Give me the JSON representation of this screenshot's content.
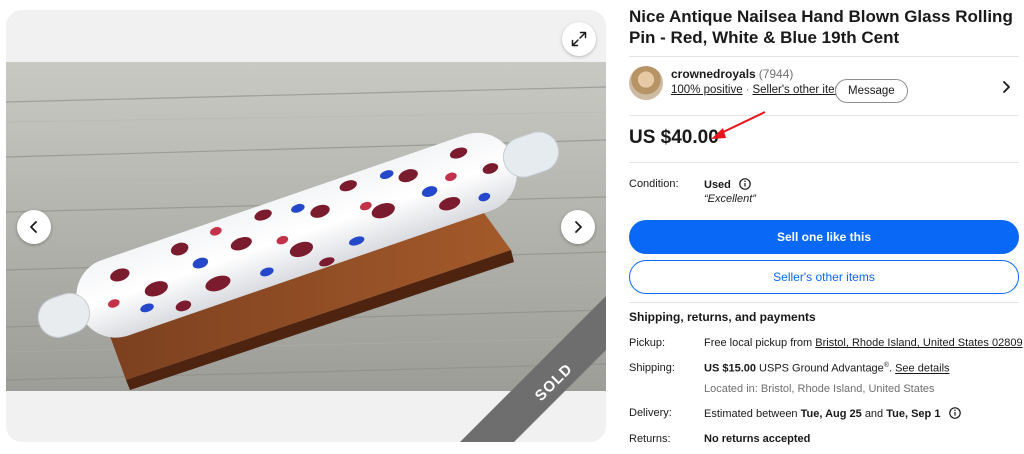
{
  "gallery": {
    "sold_label": "SOLD"
  },
  "listing": {
    "title": "Nice Antique Nailsea Hand Blown Glass Rolling Pin - Red, White & Blue 19th Cent",
    "price": "US $40.00"
  },
  "seller": {
    "name": "crownedroyals",
    "score": "(7944)",
    "positive": "100% positive",
    "other_items": "Seller's other items",
    "message_label": "Message"
  },
  "condition": {
    "label": "Condition:",
    "value": "Used",
    "note": "“Excellent”"
  },
  "actions": {
    "sell_one": "Sell one like this",
    "sellers_other_items": "Seller's other items"
  },
  "shipping": {
    "section_title": "Shipping, returns, and payments",
    "pickup_label": "Pickup:",
    "pickup_text": "Free local pickup from",
    "pickup_location": "Bristol, Rhode Island, United States 02809",
    "shipping_label": "Shipping:",
    "shipping_price": "US $15.00",
    "shipping_service": "USPS Ground Advantage",
    "shipping_reg": "®",
    "see_details": "See details",
    "located_in": "Located in: Bristol, Rhode Island, United States",
    "delivery_label": "Delivery:",
    "delivery_prefix": "Estimated between",
    "delivery_start": "Tue, Aug 25",
    "delivery_and": "and",
    "delivery_end": "Tue, Sep 1",
    "returns_label": "Returns:",
    "returns_value": "No returns accepted"
  },
  "colors": {
    "primary_blue": "#0968f6",
    "annotation_red": "#e8141b",
    "sold_ribbon": "#6e6e6e"
  }
}
